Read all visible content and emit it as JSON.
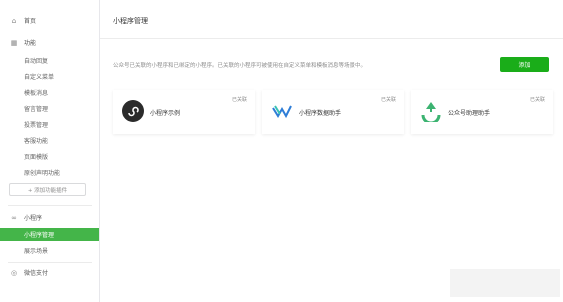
{
  "sidebar": {
    "home": "首页",
    "function_group": "功能",
    "function_items": [
      "自动回复",
      "自定义菜单",
      "模板消息",
      "留言管理",
      "投票管理",
      "客服功能",
      "页面模版",
      "原创声明功能"
    ],
    "add_function": "+ 添加功能插件",
    "miniprogram_group": "小程序",
    "miniprogram_items": [
      "小程序管理",
      "展示场景"
    ],
    "bottom_item": "微信支付"
  },
  "main": {
    "title": "小程序管理",
    "description": "公众号已关联的小程序和已绑定的小程序。已关联的小程序可被使用在自定义菜单和模板消息等场景中。",
    "add_button": "添加"
  },
  "cards": [
    {
      "name": "小程序示例",
      "status": "已关联"
    },
    {
      "name": "小程序数据助手",
      "status": "已关联"
    },
    {
      "name": "公众号助理助手",
      "status": "已关联"
    }
  ],
  "colors": {
    "accent": "#44b549",
    "button": "#1aad19"
  }
}
